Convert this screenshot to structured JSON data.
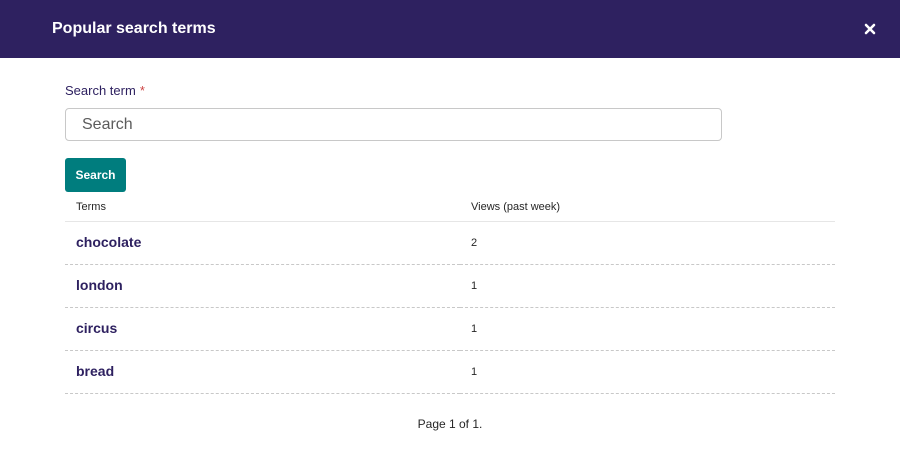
{
  "modal": {
    "title": "Popular search terms",
    "close_icon": "close-icon"
  },
  "form": {
    "label": "Search term",
    "required_mark": "*",
    "placeholder": "Search",
    "value": "",
    "button_label": "Search"
  },
  "table": {
    "headers": [
      "Terms",
      "Views (past week)"
    ],
    "rows": [
      {
        "term": "chocolate",
        "views": "2"
      },
      {
        "term": "london",
        "views": "1"
      },
      {
        "term": "circus",
        "views": "1"
      },
      {
        "term": "bread",
        "views": "1"
      }
    ]
  },
  "pagination": {
    "text": "Page 1 of 1."
  },
  "colors": {
    "header_bg": "#2e2160",
    "accent_button": "#007d7e",
    "term_link": "#2e2160",
    "required": "#cd4444"
  }
}
